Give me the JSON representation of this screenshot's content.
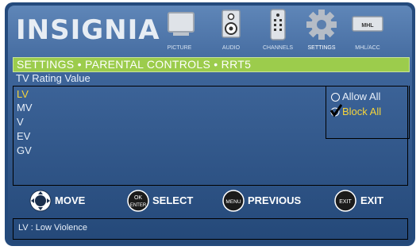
{
  "brand": {
    "name": "INSIGNIA"
  },
  "top_menu": {
    "items": [
      {
        "label": "PICTURE",
        "icon": "tv-icon",
        "active": false
      },
      {
        "label": "AUDIO",
        "icon": "speaker-icon",
        "active": false
      },
      {
        "label": "CHANNELS",
        "icon": "remote-icon",
        "active": false
      },
      {
        "label": "SETTINGS",
        "icon": "gear-icon",
        "active": true
      },
      {
        "label": "MHL/ACC",
        "icon": "mhl-icon",
        "badge": "MHL",
        "active": false
      }
    ]
  },
  "breadcrumb": {
    "title": "SETTINGS • PARENTAL CONTROLS • RRT5"
  },
  "list": {
    "header": "TV Rating Value",
    "items": [
      {
        "label": "LV",
        "selected": true
      },
      {
        "label": "MV",
        "selected": false
      },
      {
        "label": "V",
        "selected": false
      },
      {
        "label": "EV",
        "selected": false
      },
      {
        "label": "GV",
        "selected": false
      }
    ]
  },
  "options": {
    "allow_all": "Allow All",
    "block_all": "Block All",
    "selected": "block_all"
  },
  "controls": {
    "move": {
      "label": "MOVE",
      "icon": "dpad-icon"
    },
    "select": {
      "label": "SELECT",
      "icon_text_top": "OK",
      "icon_text_bottom": "ENTER"
    },
    "previous": {
      "label": "PREVIOUS",
      "icon_text": "MENU"
    },
    "exit": {
      "label": "EXIT",
      "icon_text": "EXIT"
    }
  },
  "help": {
    "text": "LV : Low Violence"
  },
  "colors": {
    "panel_blue": "#3d6499",
    "highlight_green": "#9ccc4c",
    "selected_yellow": "#f5d43b"
  }
}
